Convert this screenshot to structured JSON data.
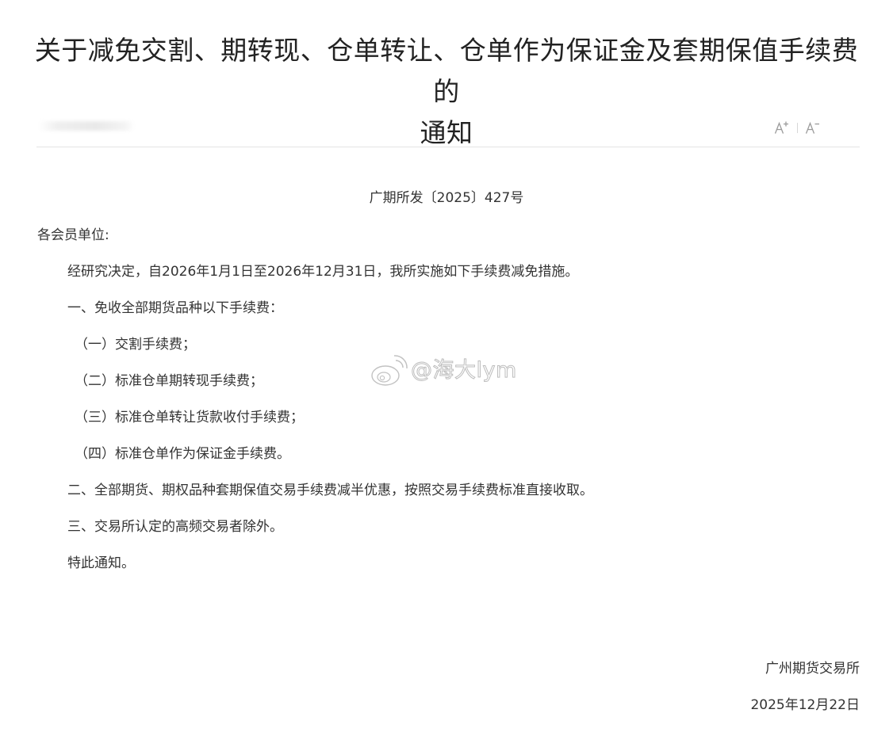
{
  "header": {
    "title_line1": "关于减免交割、期转现、仓单转让、仓单作为保证金及套期保值手续费的",
    "title_line2": "通知",
    "font_increase_icon": "font-size-increase-icon",
    "font_decrease_icon": "font-size-decrease-icon"
  },
  "body": {
    "doc_number": "广期所发〔2025〕427号",
    "salutation": "各会员单位:",
    "intro": "经研究决定，自2026年1月1日至2026年12月31日，我所实施如下手续费减免措施。",
    "section1_title": "一、免收全部期货品种以下手续费：",
    "section1_items": [
      "（一）交割手续费；",
      "（二）标准仓单期转现手续费；",
      "（三）标准仓单转让货款收付手续费；",
      "（四）标准仓单作为保证金手续费。"
    ],
    "section2": "二、全部期货、期权品种套期保值交易手续费减半优惠，按照交易手续费标准直接收取。",
    "section3": "三、交易所认定的高频交易者除外。",
    "closing": "特此通知。"
  },
  "signature": {
    "organization": "广州期货交易所",
    "date": "2025年12月22日"
  },
  "watermark": {
    "text": "@海大lym",
    "icon": "weibo-logo-icon"
  },
  "colors": {
    "text": "#333333",
    "title": "#222222",
    "divider": "#e4e4e4",
    "icon": "#9a9a9a"
  }
}
